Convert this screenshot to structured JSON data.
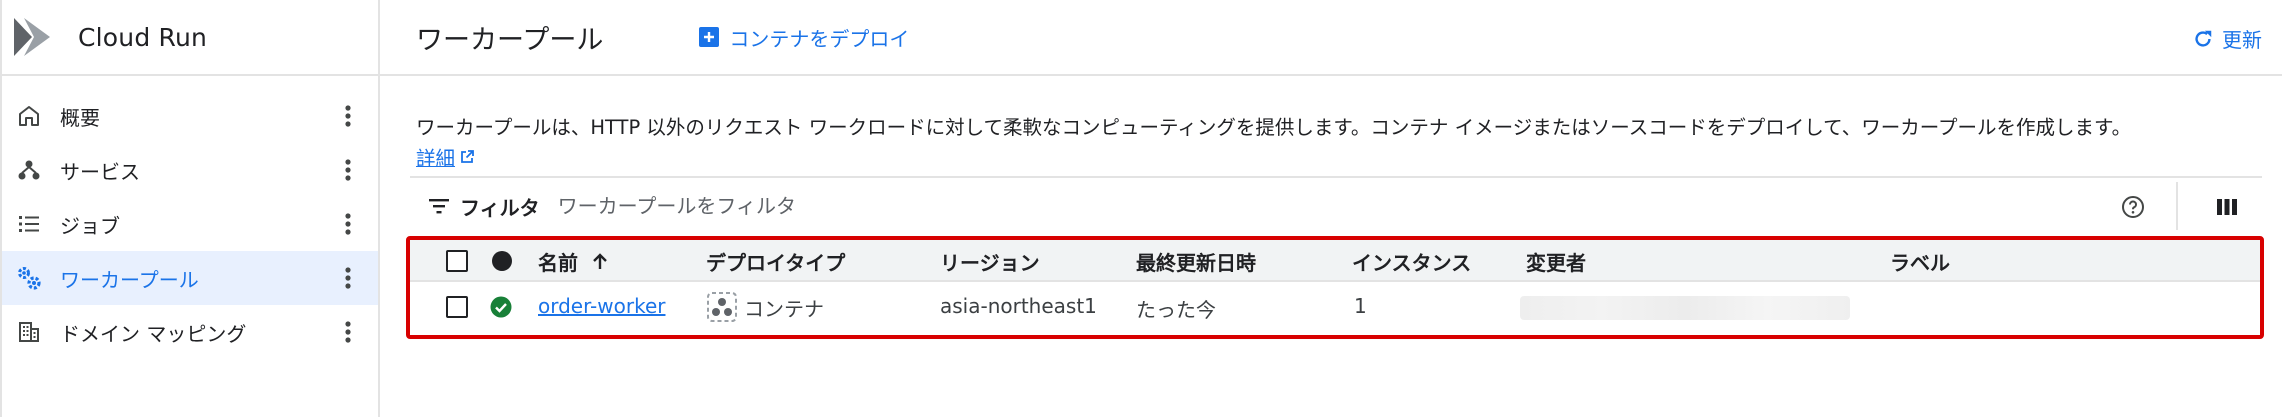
{
  "sidebar": {
    "product_name": "Cloud Run",
    "items": [
      {
        "label": "概要",
        "icon": "home-icon",
        "active": false
      },
      {
        "label": "サービス",
        "icon": "services-icon",
        "active": false
      },
      {
        "label": "ジョブ",
        "icon": "list-icon",
        "active": false
      },
      {
        "label": "ワーカープール",
        "icon": "gears-icon",
        "active": true
      },
      {
        "label": "ドメイン マッピング",
        "icon": "building-icon",
        "active": false
      }
    ]
  },
  "header": {
    "title": "ワーカープール",
    "deploy_label": "コンテナをデプロイ",
    "refresh_label": "更新"
  },
  "main": {
    "description": "ワーカープールは、HTTP 以外のリクエスト ワークロードに対して柔軟なコンピューティングを提供します。コンテナ イメージまたはソースコードをデプロイして、ワーカープールを作成します。",
    "learn_more": "詳細"
  },
  "filter": {
    "label": "フィルタ",
    "placeholder": "ワーカープールをフィルタ"
  },
  "table": {
    "columns": [
      "名前",
      "デプロイタイプ",
      "リージョン",
      "最終更新日時",
      "インスタンス",
      "変更者",
      "ラベル"
    ],
    "rows": [
      {
        "name": "order-worker",
        "deploy_type": "コンテナ",
        "region": "asia-northeast1",
        "updated": "たった今",
        "instances": "1",
        "changed_by": "",
        "labels": ""
      }
    ]
  },
  "colors": {
    "accent": "#1a73e8",
    "active_bg": "#e8f0fe",
    "status_ok": "#188038",
    "highlight_border": "#d80000"
  }
}
